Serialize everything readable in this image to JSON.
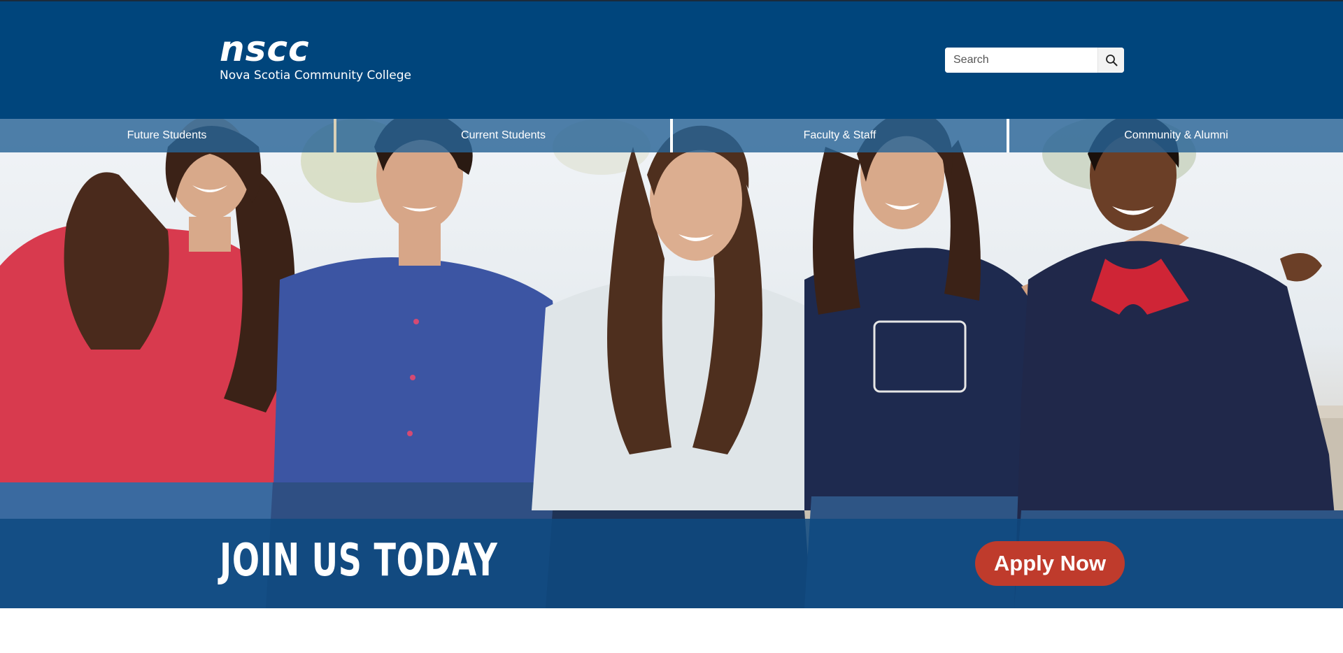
{
  "header": {
    "logo_mark": "nscc",
    "logo_subtitle": "Nova Scotia Community College"
  },
  "search": {
    "placeholder": "Search",
    "value": "",
    "button_icon": "search-icon"
  },
  "nav": {
    "items": [
      {
        "label": "Future Students"
      },
      {
        "label": "Current Students"
      },
      {
        "label": "Faculty & Staff"
      },
      {
        "label": "Community & Alumni"
      }
    ]
  },
  "hero": {
    "image": "five smiling students seated together outdoors"
  },
  "cta": {
    "heading": "JOIN US TODAY",
    "button_label": "Apply Now"
  },
  "colors": {
    "header_bg": "#00457c",
    "nav_bg": "#2f6a99",
    "cta_overlay": "#0e4980",
    "apply_button": "#bf3b2c",
    "text_on_dark": "#ffffff"
  }
}
